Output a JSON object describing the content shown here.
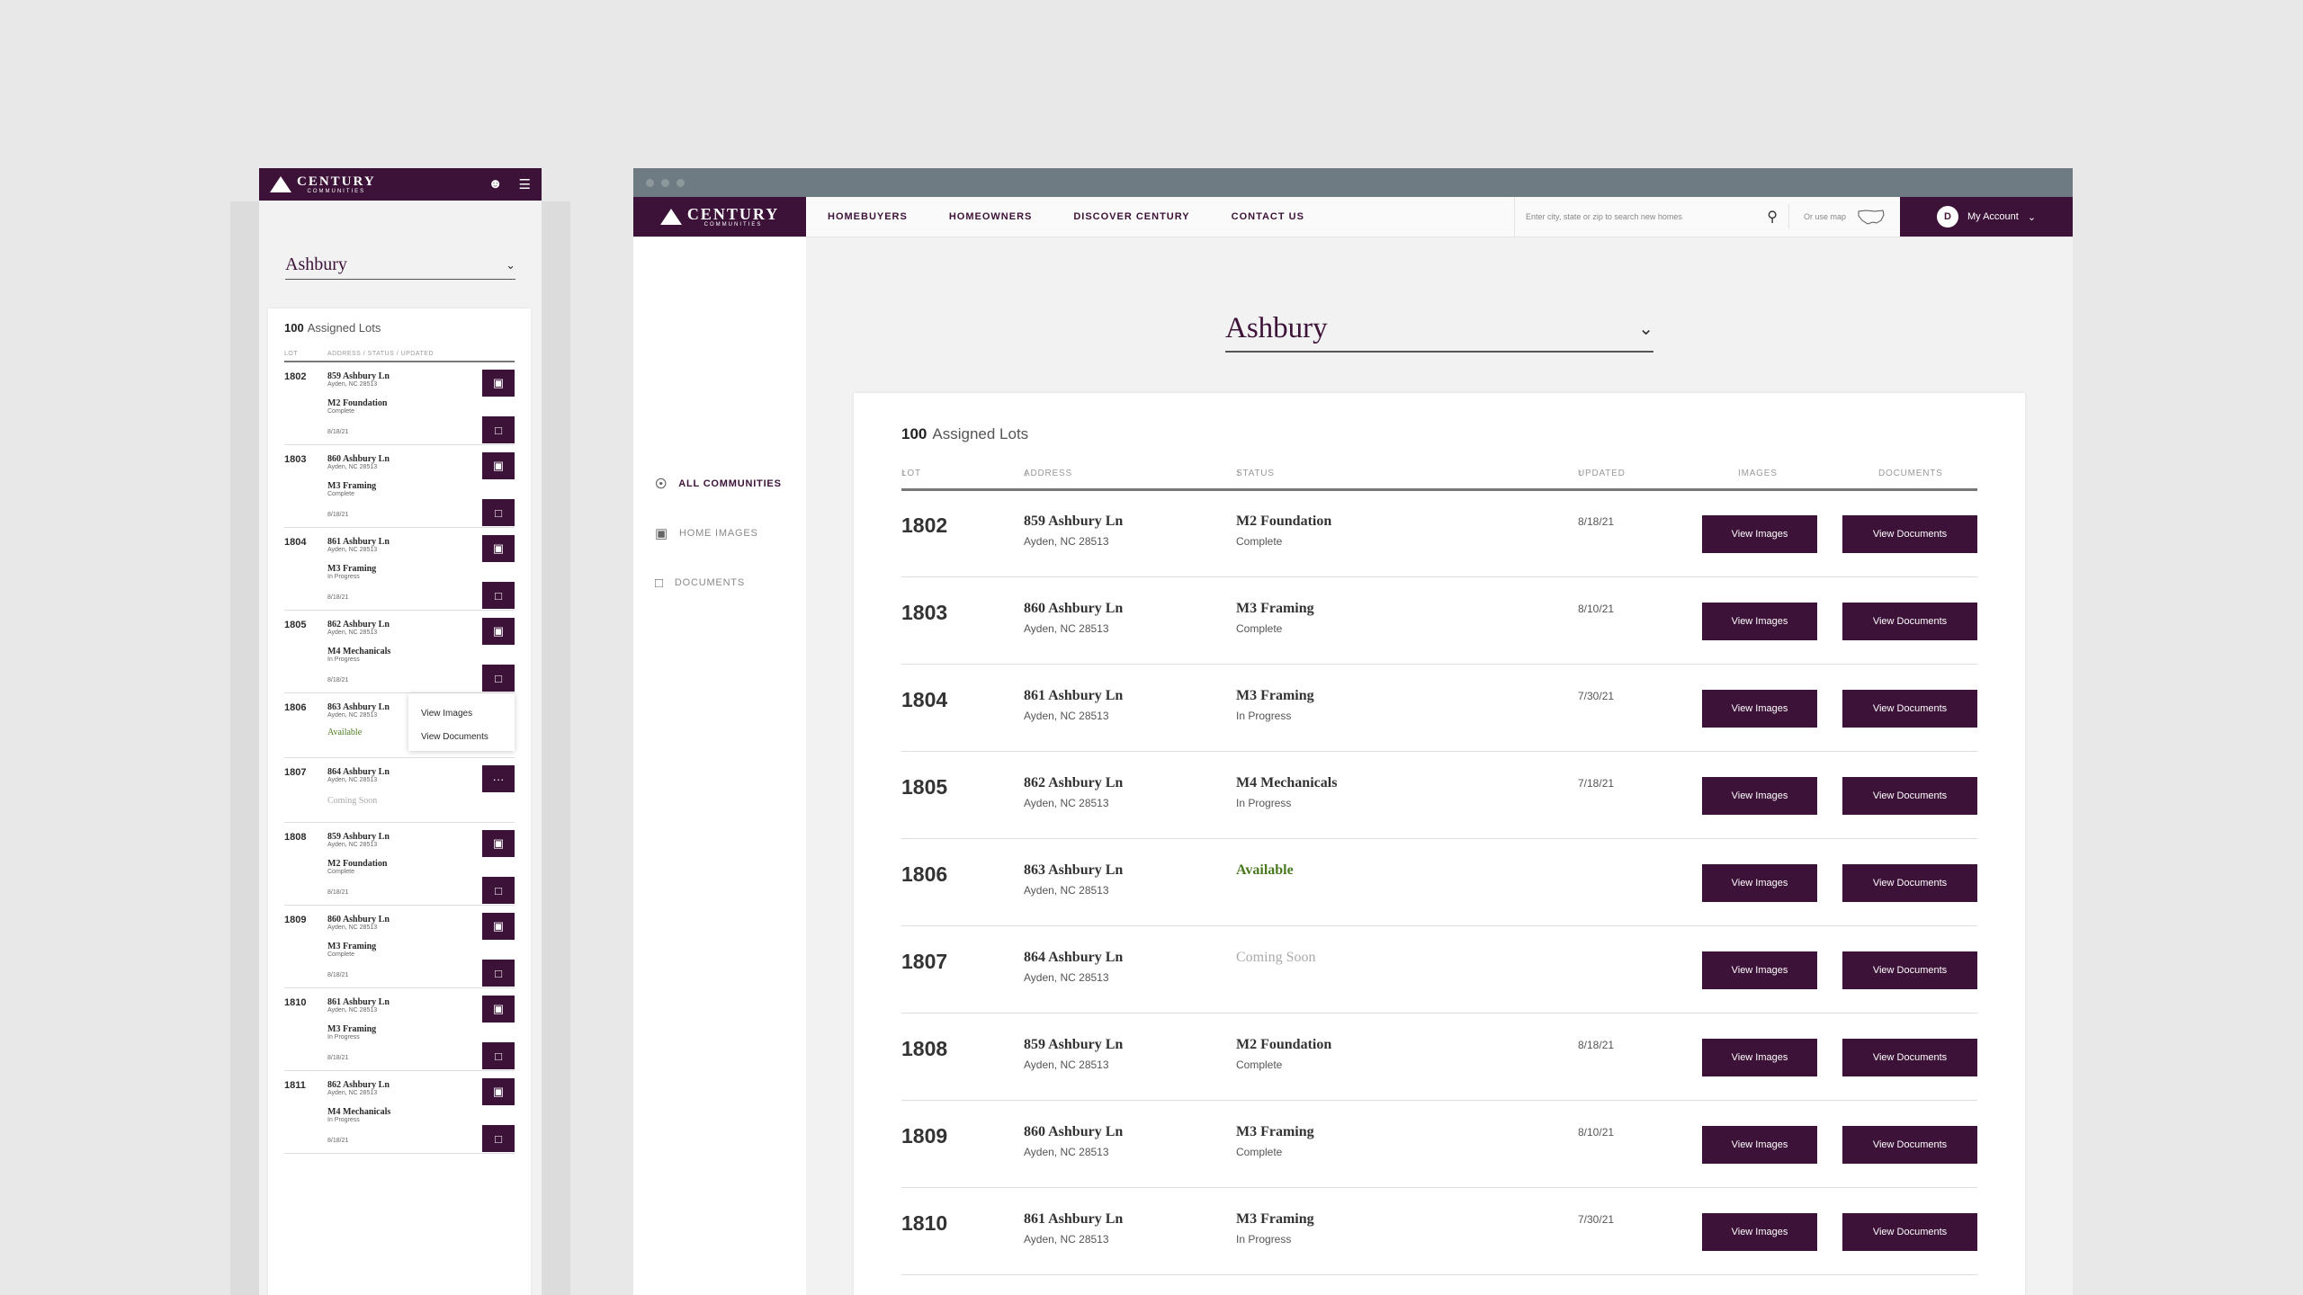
{
  "brand": {
    "logo_main": "CENTURY",
    "logo_sub": "COMMUNITIES"
  },
  "community": {
    "selected": "Ashbury"
  },
  "assigned": {
    "count": "100",
    "label": "Assigned Lots"
  },
  "mobile": {
    "columns": [
      "LOT",
      "ADDRESS / STATUS / UPDATED"
    ],
    "popup": {
      "images": "View Images",
      "documents": "View Documents"
    },
    "rows": [
      {
        "lot": "1802",
        "addr": "859 Ashbury Ln",
        "city": "Ayden, NC 28513",
        "stage": "M2 Foundation",
        "status": "Complete",
        "date": "8/18/21"
      },
      {
        "lot": "1803",
        "addr": "860 Ashbury Ln",
        "city": "Ayden, NC 28513",
        "stage": "M3 Framing",
        "status": "Complete",
        "date": "8/18/21"
      },
      {
        "lot": "1804",
        "addr": "861 Ashbury Ln",
        "city": "Ayden, NC 28513",
        "stage": "M3 Framing",
        "status": "In Progress",
        "date": "8/18/21"
      },
      {
        "lot": "1805",
        "addr": "862 Ashbury Ln",
        "city": "Ayden, NC 28513",
        "stage": "M4 Mechanicals",
        "status": "In Progress",
        "date": "8/18/21"
      },
      {
        "lot": "1806",
        "addr": "863 Ashbury Ln",
        "city": "Ayden, NC 28513",
        "avail": "Available"
      },
      {
        "lot": "1807",
        "addr": "864 Ashbury Ln",
        "city": "Ayden, NC 28513",
        "soon": "Coming Soon"
      },
      {
        "lot": "1808",
        "addr": "859 Ashbury Ln",
        "city": "Ayden, NC 28513",
        "stage": "M2 Foundation",
        "status": "Complete",
        "date": "8/18/21"
      },
      {
        "lot": "1809",
        "addr": "860 Ashbury Ln",
        "city": "Ayden, NC 28513",
        "stage": "M3 Framing",
        "status": "Complete",
        "date": "8/18/21"
      },
      {
        "lot": "1810",
        "addr": "861 Ashbury Ln",
        "city": "Ayden, NC 28513",
        "stage": "M3 Framing",
        "status": "In Progress",
        "date": "8/18/21"
      },
      {
        "lot": "1811",
        "addr": "862 Ashbury Ln",
        "city": "Ayden, NC 28513",
        "stage": "M4 Mechanicals",
        "status": "In Progress",
        "date": "8/18/21"
      }
    ]
  },
  "desktop": {
    "nav": [
      "HOMEBUYERS",
      "HOMEOWNERS",
      "DISCOVER CENTURY",
      "CONTACT US"
    ],
    "search_placeholder": "Enter city, state or zip to search new homes",
    "map_label": "Or use map",
    "account": {
      "initial": "D",
      "label": "My Account"
    },
    "sidebar": [
      "ALL COMMUNITIES",
      "HOME IMAGES",
      "DOCUMENTS"
    ],
    "columns": {
      "lot": "LOT",
      "address": "ADDRESS",
      "status": "STATUS",
      "updated": "UPDATED",
      "images": "IMAGES",
      "documents": "DOCUMENTS"
    },
    "btn_images": "View Images",
    "btn_documents": "View Documents",
    "rows": [
      {
        "lot": "1802",
        "addr": "859 Ashbury Ln",
        "city": "Ayden, NC 28513",
        "stage": "M2 Foundation",
        "status": "Complete",
        "date": "8/18/21"
      },
      {
        "lot": "1803",
        "addr": "860 Ashbury Ln",
        "city": "Ayden, NC 28513",
        "stage": "M3 Framing",
        "status": "Complete",
        "date": "8/10/21"
      },
      {
        "lot": "1804",
        "addr": "861 Ashbury Ln",
        "city": "Ayden, NC 28513",
        "stage": "M3 Framing",
        "status": "In Progress",
        "date": "7/30/21"
      },
      {
        "lot": "1805",
        "addr": "862 Ashbury Ln",
        "city": "Ayden, NC 28513",
        "stage": "M4 Mechanicals",
        "status": "In Progress",
        "date": "7/18/21"
      },
      {
        "lot": "1806",
        "addr": "863 Ashbury Ln",
        "city": "Ayden, NC 28513",
        "stage": "Available",
        "status": "",
        "date": ""
      },
      {
        "lot": "1807",
        "addr": "864 Ashbury Ln",
        "city": "Ayden, NC 28513",
        "stage": "Coming Soon",
        "status": "",
        "date": ""
      },
      {
        "lot": "1808",
        "addr": "859 Ashbury Ln",
        "city": "Ayden, NC 28513",
        "stage": "M2 Foundation",
        "status": "Complete",
        "date": "8/18/21"
      },
      {
        "lot": "1809",
        "addr": "860 Ashbury Ln",
        "city": "Ayden, NC 28513",
        "stage": "M3 Framing",
        "status": "Complete",
        "date": "8/10/21"
      },
      {
        "lot": "1810",
        "addr": "861 Ashbury Ln",
        "city": "Ayden, NC 28513",
        "stage": "M3 Framing",
        "status": "In Progress",
        "date": "7/30/21"
      }
    ]
  },
  "colors": {
    "brand": "#3c1238",
    "available": "#4a7a1f",
    "coming_soon": "#aaaaaa"
  }
}
